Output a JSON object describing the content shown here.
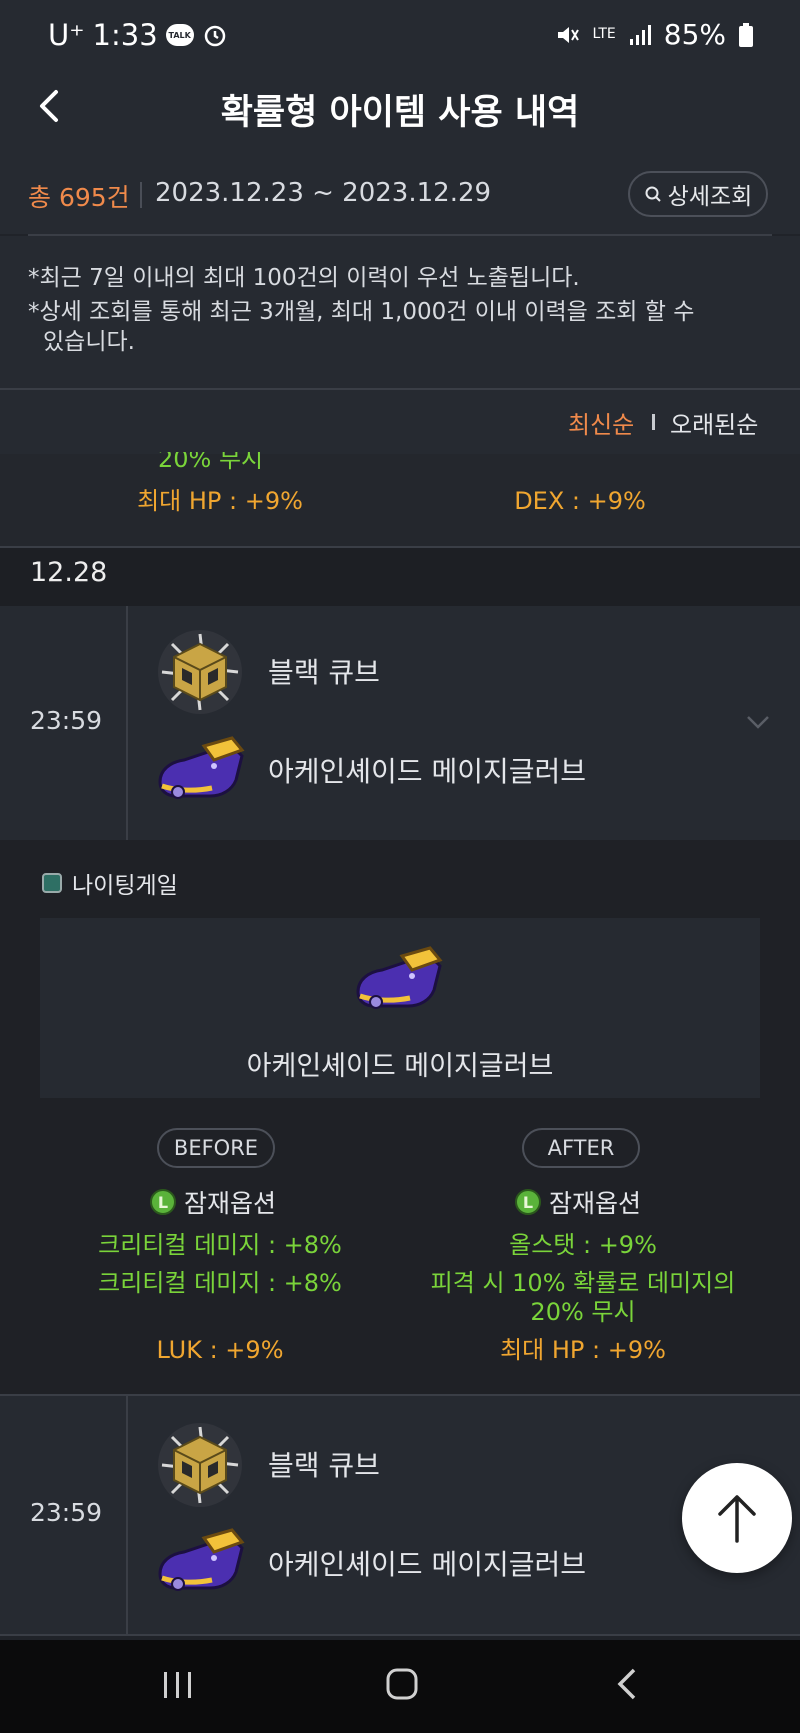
{
  "status_bar": {
    "carrier": "U⁺",
    "time": "1:33",
    "talk_badge": "TALK",
    "network": "LTE",
    "battery": "85%"
  },
  "header": {
    "title": "확률형 아이템 사용 내역"
  },
  "summary": {
    "total": "총 695건",
    "date_range": "2023.12.23 ~ 2023.12.29",
    "detail_button": "상세조회"
  },
  "notice": {
    "line1": "*최근 7일 이내의 최대 100건의 이력이 우선 노출됩니다.",
    "line2a": "*상세 조회를 통해 최근 3개월, 최대 1,000건 이내 이력을 조회 할 수",
    "line2b": "있습니다."
  },
  "sort": {
    "newest": "최신순",
    "oldest": "오래된순"
  },
  "partial_entry": {
    "left_cut": "20% 무시",
    "left_line": "최대 HP : +9%",
    "right_line": "DEX : +9%"
  },
  "date_header": "12.28",
  "entries": [
    {
      "time": "23:59",
      "cube_name": "블랙 큐브",
      "item_name": "아케인셰이드 메이지글러브"
    },
    {
      "time": "23:59",
      "cube_name": "블랙 큐브",
      "item_name": "아케인셰이드 메이지글러브"
    }
  ],
  "expanded": {
    "server": "나이팅게일",
    "item_name": "아케인셰이드 메이지글러브",
    "before": {
      "label": "BEFORE",
      "potential_title": "잠재옵션",
      "lines": [
        "크리티컬 데미지 : +8%",
        "크리티컬 데미지 : +8%",
        "LUK : +9%"
      ]
    },
    "after": {
      "label": "AFTER",
      "potential_title": "잠재옵션",
      "lines": [
        "올스탯 : +9%",
        "피격 시 10% 확률로 데미지의",
        "20% 무시",
        "최대 HP : +9%"
      ]
    },
    "rank_icon_letter": "L"
  },
  "colors": {
    "accent_orange": "#f08a4b",
    "option_green": "#7ad43a",
    "option_gold": "#f0a630",
    "background": "#202329"
  },
  "icons": [
    "back-arrow-icon",
    "search-icon",
    "chevron-down-icon",
    "arrow-up-icon",
    "black-cube-icon",
    "glove-icon",
    "server-icon"
  ]
}
